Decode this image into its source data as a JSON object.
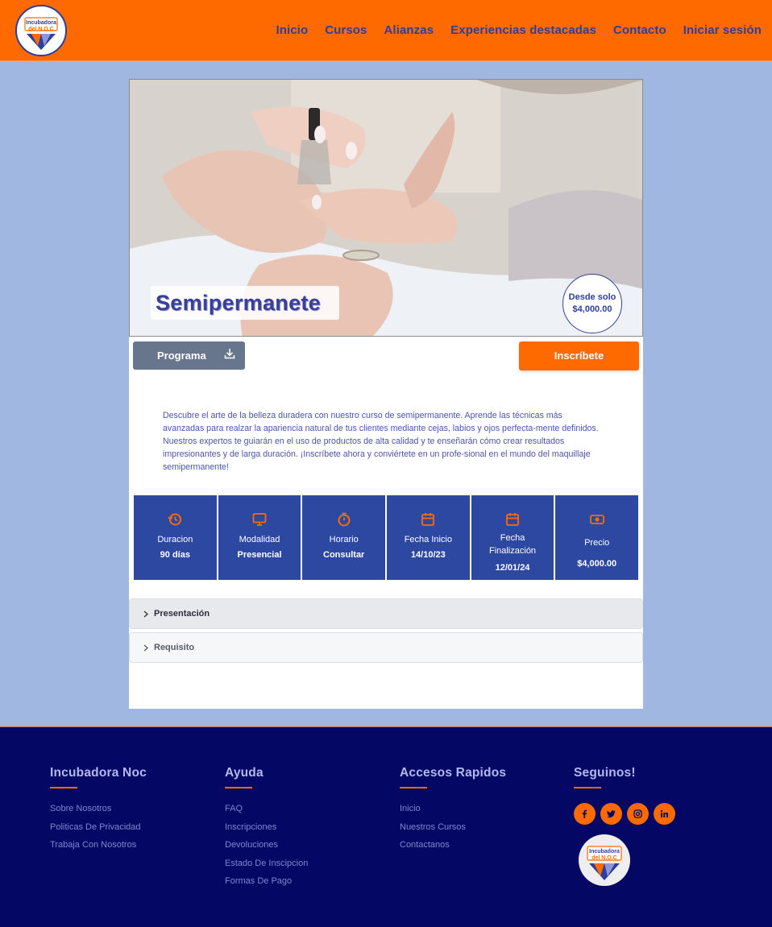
{
  "header": {
    "logo_line1": "Incubadora",
    "logo_line2": "del N.O.C",
    "nav": [
      "Inicio",
      "Cursos",
      "Alianzas",
      "Experiencias destacadas",
      "Contacto",
      "Iniciar sesión"
    ]
  },
  "course": {
    "title": "Semipermanete",
    "price_line1": "Desde solo",
    "price_line2": "$4,000.00",
    "program_button": "Programa",
    "signup_button": "Inscríbete",
    "description": "Descubre el arte de la belleza duradera con nuestro curso de semipermanente. Aprende las técnicas más avanzadas para realzar la apariencia natural de tus clientes mediante cejas, labios y ojos perfecta-mente definidos. Nuestros expertos te guiarán en el uso de productos de alta calidad y te enseñarán cómo crear resultados impresionantes y de larga duración. ¡Inscríbete ahora y conviértete en un profe-sional en el mundo del maquillaje semipermanente!"
  },
  "stats": [
    {
      "icon": "history-icon",
      "label": "Duracion",
      "value": "90 días"
    },
    {
      "icon": "monitor-icon",
      "label": "Modalidad",
      "value": "Presencial"
    },
    {
      "icon": "stopwatch-icon",
      "label": "Horario",
      "value": "Consultar"
    },
    {
      "icon": "calendar-icon",
      "label": "Fecha Inicio",
      "value": "14/10/23"
    },
    {
      "icon": "calendar-icon",
      "label": "Fecha Finalización",
      "value": "12/01/24"
    },
    {
      "icon": "money-icon",
      "label": "Precio",
      "value": "$4,000.00"
    }
  ],
  "accordion": [
    {
      "label": "Presentación"
    },
    {
      "label": "Requisito"
    }
  ],
  "footer": {
    "columns": [
      {
        "title": "Incubadora Noc",
        "links": [
          "Sobre Nosotros",
          "Politicas De Privacidad",
          "Trabaja Con Nosotros"
        ]
      },
      {
        "title": "Ayuda",
        "links": [
          "FAQ",
          "Inscripciones",
          "Devoluciones",
          "Estado De Inscipcion",
          "Formas De Pago"
        ]
      },
      {
        "title": "Accesos Rapidos",
        "links": [
          "Inicio",
          "Nuestros Cursos",
          "Contactanos"
        ]
      },
      {
        "title": "Seguinos!",
        "links": []
      }
    ],
    "socials": [
      "facebook-icon",
      "twitter-icon",
      "instagram-icon",
      "linkedin-icon"
    ]
  },
  "colors": {
    "brand_orange": "#ff6a00",
    "brand_blue": "#2c48a0",
    "footer_bg": "#040864",
    "page_bg": "#a0b7e2"
  }
}
